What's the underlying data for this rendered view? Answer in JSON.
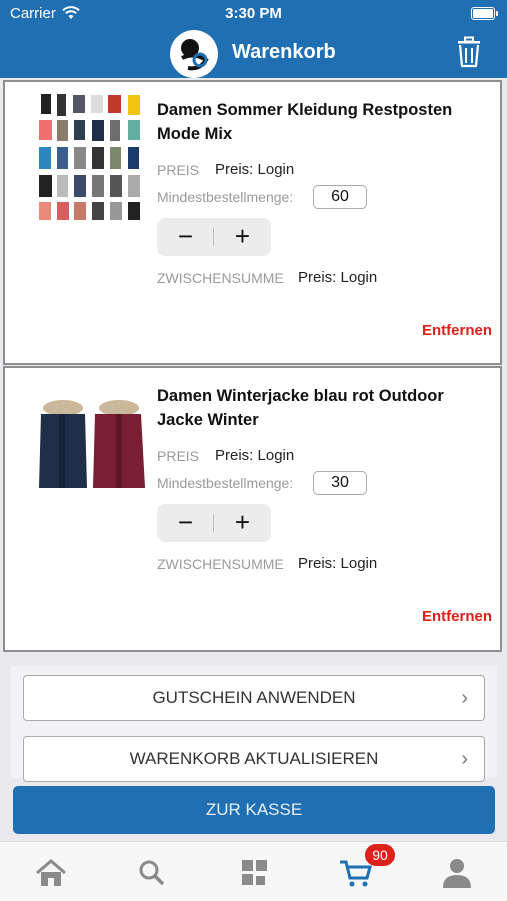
{
  "status_bar": {
    "carrier": "Carrier",
    "time": "3:30 PM"
  },
  "header": {
    "title": "Warenkorb"
  },
  "items": [
    {
      "name": "Damen Sommer Kleidung Restposten Mode Mix",
      "price_label": "PREIS",
      "price_value": "Preis: Login",
      "min_qty_label": "Mindestbestellmenge:",
      "min_qty_value": "60",
      "subtotal_label": "ZWISCHENSUMME",
      "subtotal_value": "Preis: Login",
      "remove_label": "Entfernen"
    },
    {
      "name": "Damen Winterjacke blau rot Outdoor Jacke Winter",
      "price_label": "PREIS",
      "price_value": "Preis: Login",
      "min_qty_label": "Mindestbestellmenge:",
      "min_qty_value": "30",
      "subtotal_label": "ZWISCHENSUMME",
      "subtotal_value": "Preis: Login",
      "remove_label": "Entfernen"
    }
  ],
  "stepper": {
    "minus": "−",
    "plus": "+"
  },
  "actions": {
    "coupon": "GUTSCHEIN ANWENDEN",
    "update_cart": "WARENKORB AKTUALISIEREN",
    "chevron": "›",
    "checkout": "ZUR KASSE"
  },
  "tabbar": {
    "cart_badge": "90",
    "icons": [
      "home-icon",
      "search-icon",
      "categories-icon",
      "cart-icon",
      "user-icon"
    ],
    "active_color": "#1f6fb2",
    "inactive_color": "#8a8a8a"
  },
  "colors": {
    "brand": "#1f6fb2",
    "remove": "#e0201b"
  }
}
